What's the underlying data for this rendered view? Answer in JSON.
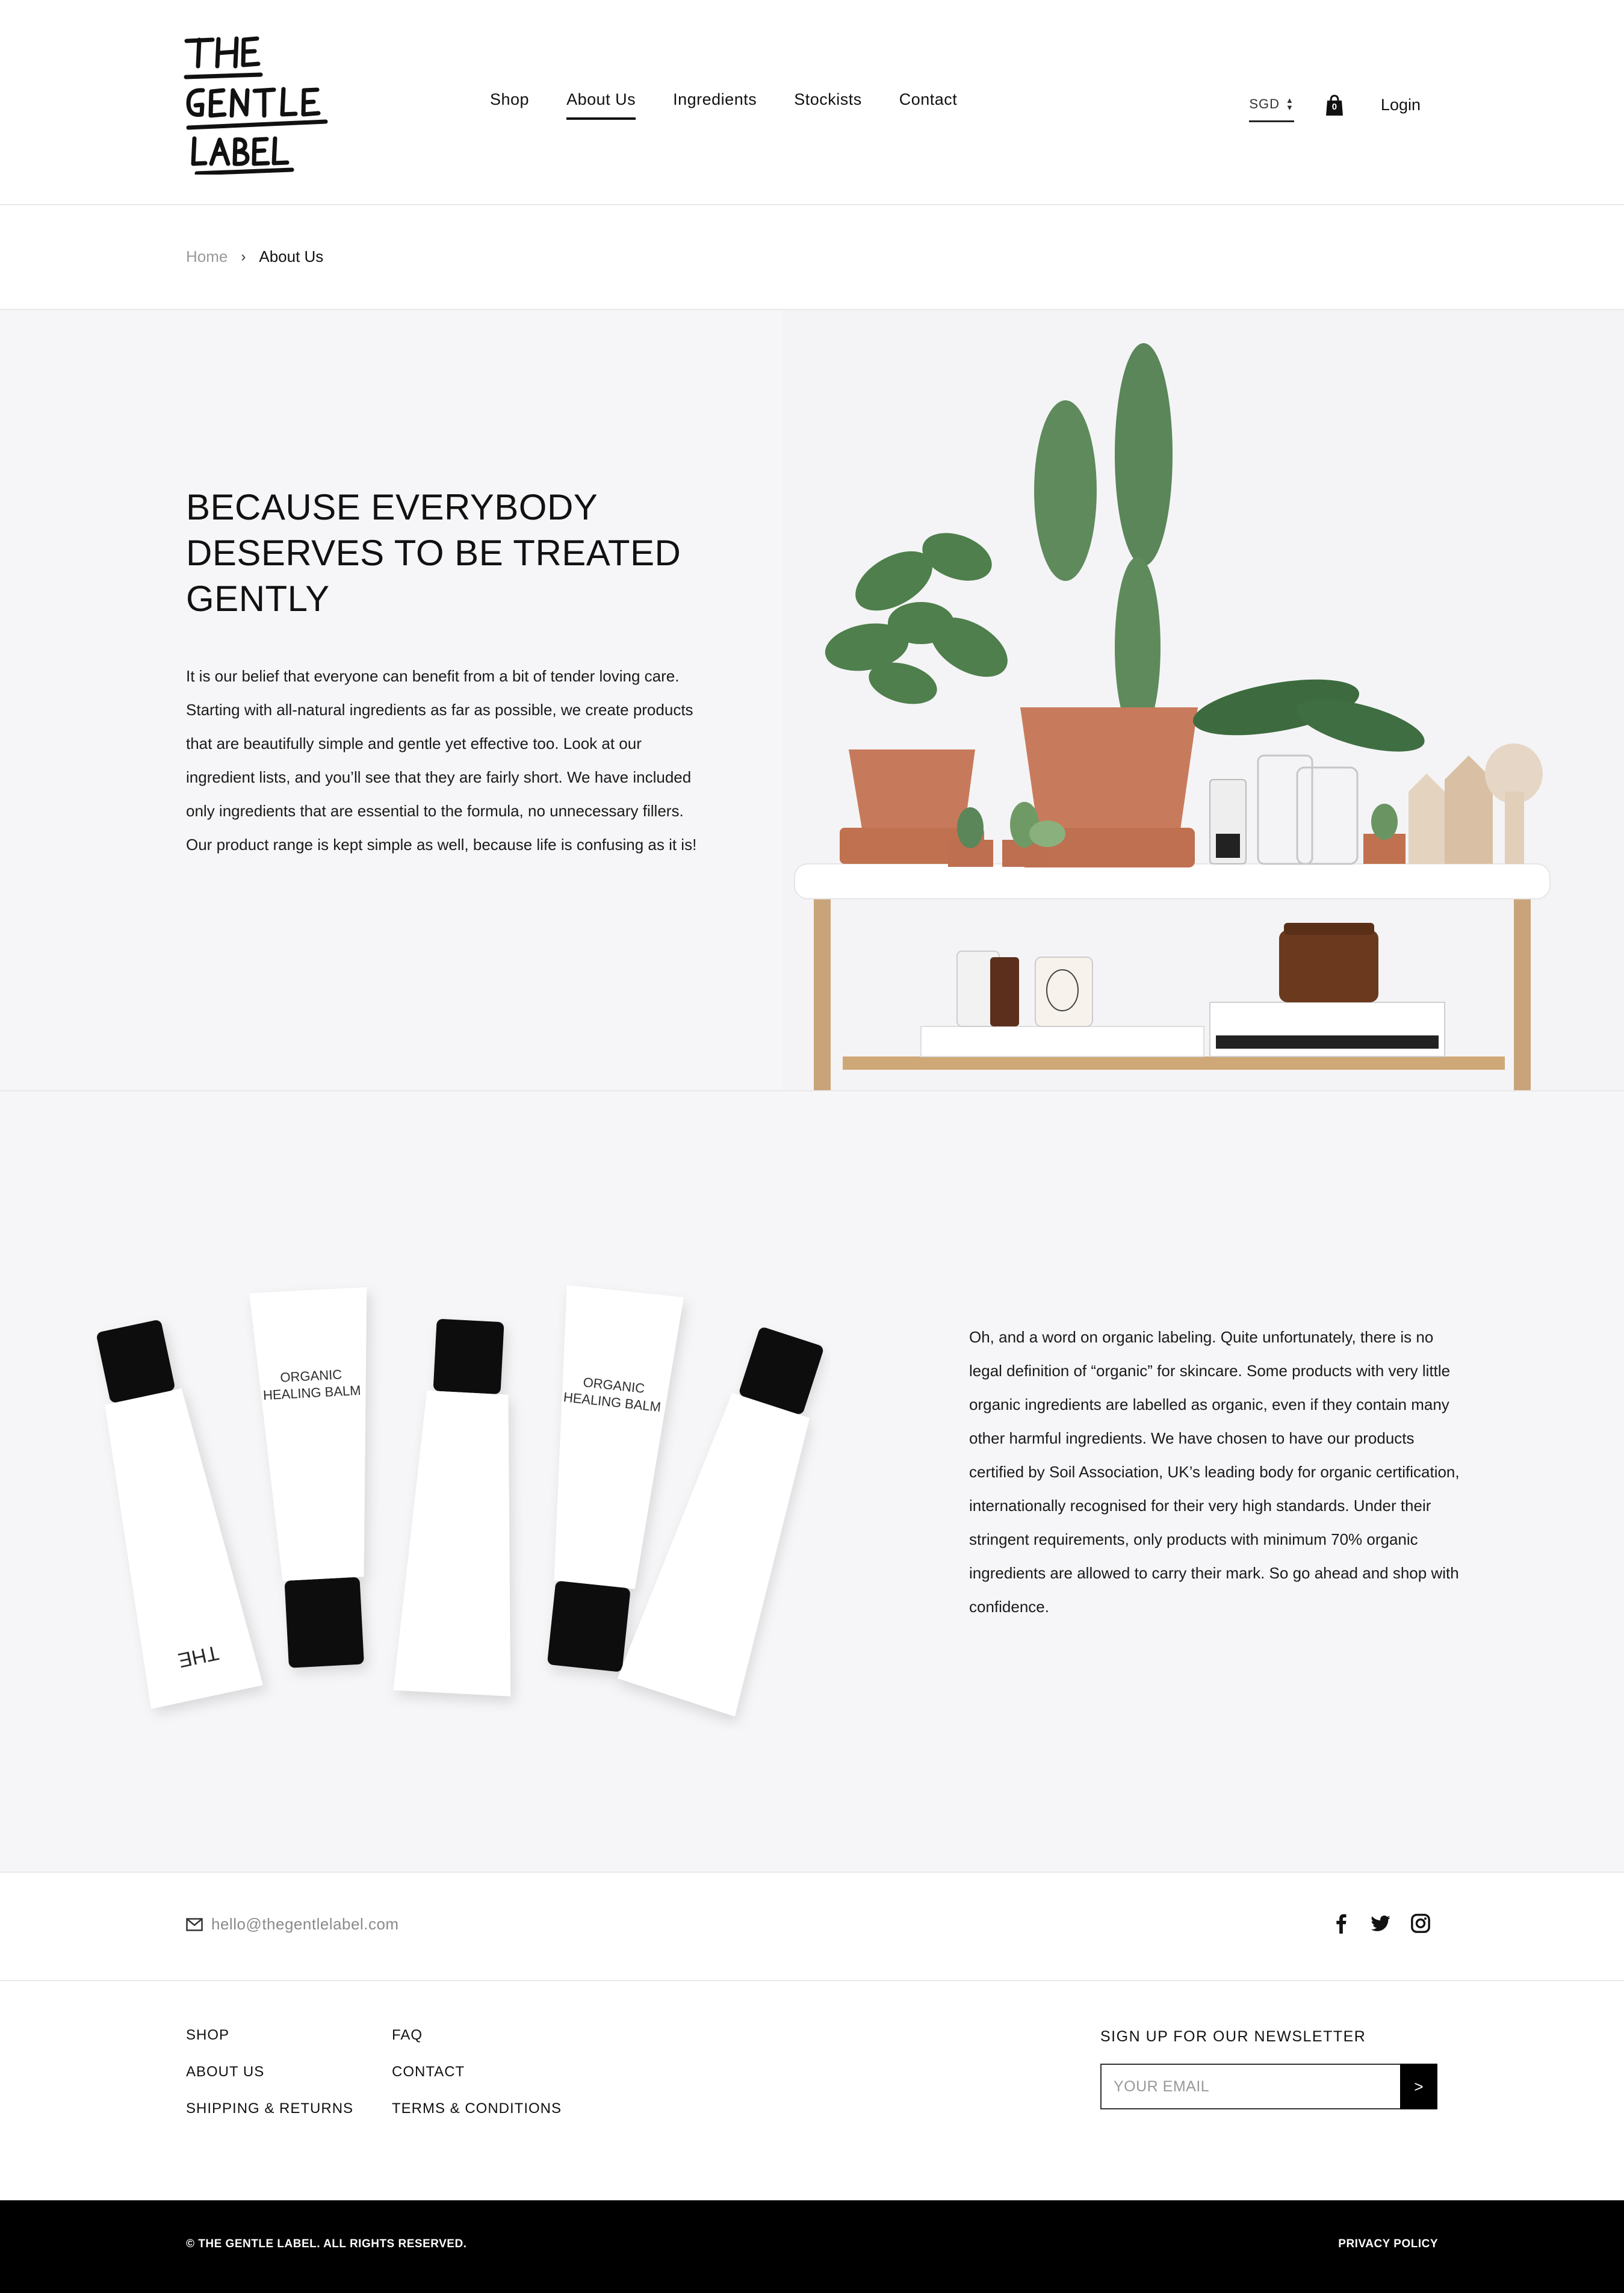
{
  "brand": {
    "logo_text": "THE GENTLE LABEL"
  },
  "nav": {
    "items": [
      {
        "label": "Shop",
        "active": false
      },
      {
        "label": "About Us",
        "active": true
      },
      {
        "label": "Ingredients",
        "active": false
      },
      {
        "label": "Stockists",
        "active": false
      },
      {
        "label": "Contact",
        "active": false
      }
    ],
    "currency": "SGD",
    "cart_count": "0",
    "login_label": "Login"
  },
  "breadcrumb": {
    "home": "Home",
    "separator": "›",
    "current": "About Us"
  },
  "hero": {
    "title": "BECAUSE EVERYBODY DESERVES TO BE TREATED GENTLY",
    "body": "It is our belief that everyone can benefit from a bit of tender loving care. Starting with all-natural ingredients as far as possible, we create products that are beautifully simple and gentle yet effective too. Look at our ingredient lists, and you’ll see that they are fairly short. We have included only ingredients that are essential to the formula, no unnecessary fillers. Our product range is kept simple as well, because life is confusing as it is!",
    "image": "plants-on-shelf-image"
  },
  "organic": {
    "body": "Oh, and a word on organic labeling. Quite unfortunately, there is no legal definition of “organic” for skincare. Some products with very little organic ingredients are labelled as organic, even if they contain many other harmful ingredients. We have chosen to have our products certified by Soil Association, UK’s leading body for organic certification, internationally recognised for their very high standards. Under their stringent requirements, only products with minimum 70% organic ingredients are allowed to carry their mark. So go ahead and shop with confidence.",
    "image": "healing-balm-tubes-image",
    "tube_label": "ORGANIC HEALING BALM"
  },
  "contact": {
    "email": "hello@thegentlelabel.com",
    "social": [
      "facebook-icon",
      "twitter-icon",
      "instagram-icon"
    ]
  },
  "footer": {
    "col1": [
      "SHOP",
      "ABOUT US",
      "SHIPPING & RETURNS"
    ],
    "col2": [
      "FAQ",
      "CONTACT",
      "TERMS & CONDITIONS"
    ],
    "newsletter_title": "SIGN UP FOR OUR NEWSLETTER",
    "email_placeholder": "YOUR EMAIL",
    "submit_label": ">",
    "copyright": "© THE GENTLE LABEL. ALL RIGHTS RESERVED.",
    "privacy": "PRIVACY POLICY"
  },
  "colors": {
    "text": "#111111",
    "muted": "#999999",
    "bg_soft": "#f6f6f8",
    "footer_bg": "#000000",
    "terracotta": "#c8795a"
  }
}
